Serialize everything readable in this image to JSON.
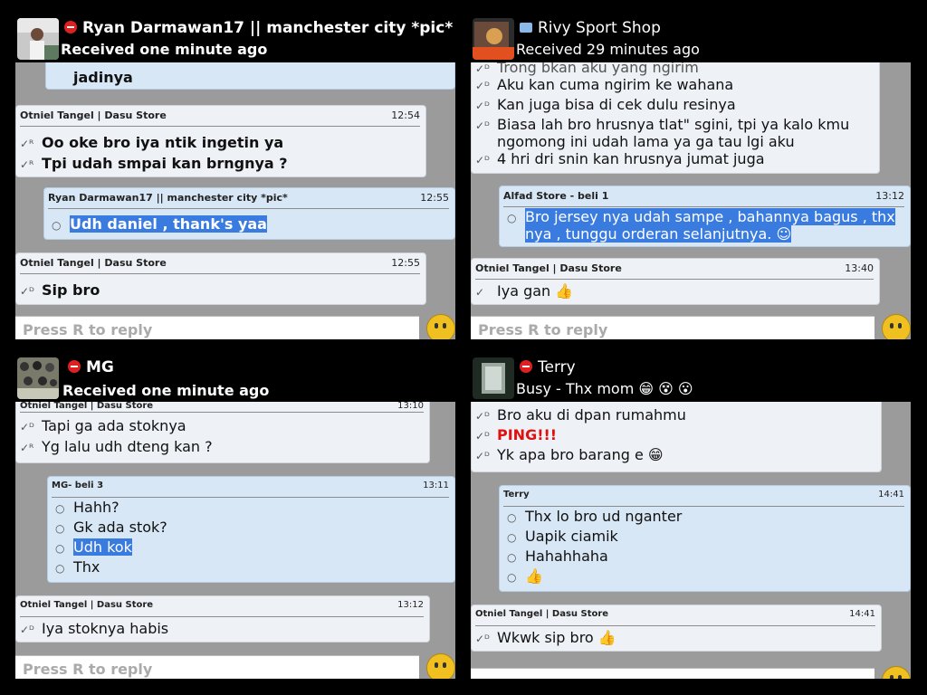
{
  "panels": [
    {
      "contact": "Ryan Darmawan17 || manchester city *pic*",
      "status": "Received one minute ago",
      "partial_top": "jadinya",
      "messages": [
        {
          "sender": "Otniel Tangel | Dasu Store",
          "time": "12:54",
          "lines": [
            "Oo oke bro iya ntik ingetin ya",
            "Tpi udah smpai kan brngnya ?"
          ]
        },
        {
          "sender": "Ryan Darmawan17 || manchester city *pic*",
          "time": "12:55",
          "lines": [
            "Udh daniel , thank's yaa"
          ]
        },
        {
          "sender": "Otniel Tangel | Dasu Store",
          "time": "12:55",
          "lines": [
            "Sip bro"
          ]
        }
      ],
      "reply_placeholder": "Press R to reply"
    },
    {
      "contact": "Rivy Sport Shop",
      "status": "Received 29 minutes ago",
      "partial_top": "Trong bkan aku yang ngirim",
      "messages": [
        {
          "lines": [
            "Aku kan cuma ngirim ke wahana",
            "Kan juga bisa di cek dulu resinya",
            "Biasa lah bro hrusnya tlat\" sgini, tpi ya kalo kmu",
            "ngomong ini udah lama ya ga tau lgi aku",
            "4 hri dri snin kan hrusnya jumat juga"
          ]
        },
        {
          "sender": "Alfad Store - beli 1",
          "time": "13:12",
          "lines": [
            "Bro jersey nya udah sampe , bahannya bagus , thx",
            "nya , tunggu orderan selanjutnya."
          ]
        },
        {
          "sender": "Otniel Tangel | Dasu Store",
          "time": "13:40",
          "lines": [
            "Iya gan"
          ]
        }
      ],
      "reply_placeholder": "Press R to reply"
    },
    {
      "contact": "MG",
      "status": "Received one minute ago",
      "messages": [
        {
          "sender": "Otniel Tangel | Dasu Store",
          "time": "13:10",
          "lines": [
            "Tapi ga ada stoknya",
            "Yg lalu udh dteng kan ?"
          ]
        },
        {
          "sender": "MG- beli 3",
          "time": "13:11",
          "lines": [
            "Hahh?",
            "Gk ada stok?",
            "Udh kok",
            "Thx"
          ]
        },
        {
          "sender": "Otniel Tangel | Dasu Store",
          "time": "13:12",
          "lines": [
            "Iya stoknya habis"
          ]
        }
      ],
      "reply_placeholder": "Press R to reply"
    },
    {
      "contact": "Terry",
      "status": "Busy - Thx mom",
      "messages": [
        {
          "lines": [
            "Bro aku di dpan rumahmu",
            "PING!!!",
            "Yk apa bro barang e"
          ]
        },
        {
          "sender": "Terry",
          "time": "14:41",
          "lines": [
            "Thx lo bro ud nganter",
            "Uapik ciamik",
            "Hahahhaha"
          ]
        },
        {
          "sender": "Otniel Tangel | Dasu Store",
          "time": "14:41",
          "lines": [
            "Wkwk sip bro"
          ]
        }
      ]
    }
  ]
}
